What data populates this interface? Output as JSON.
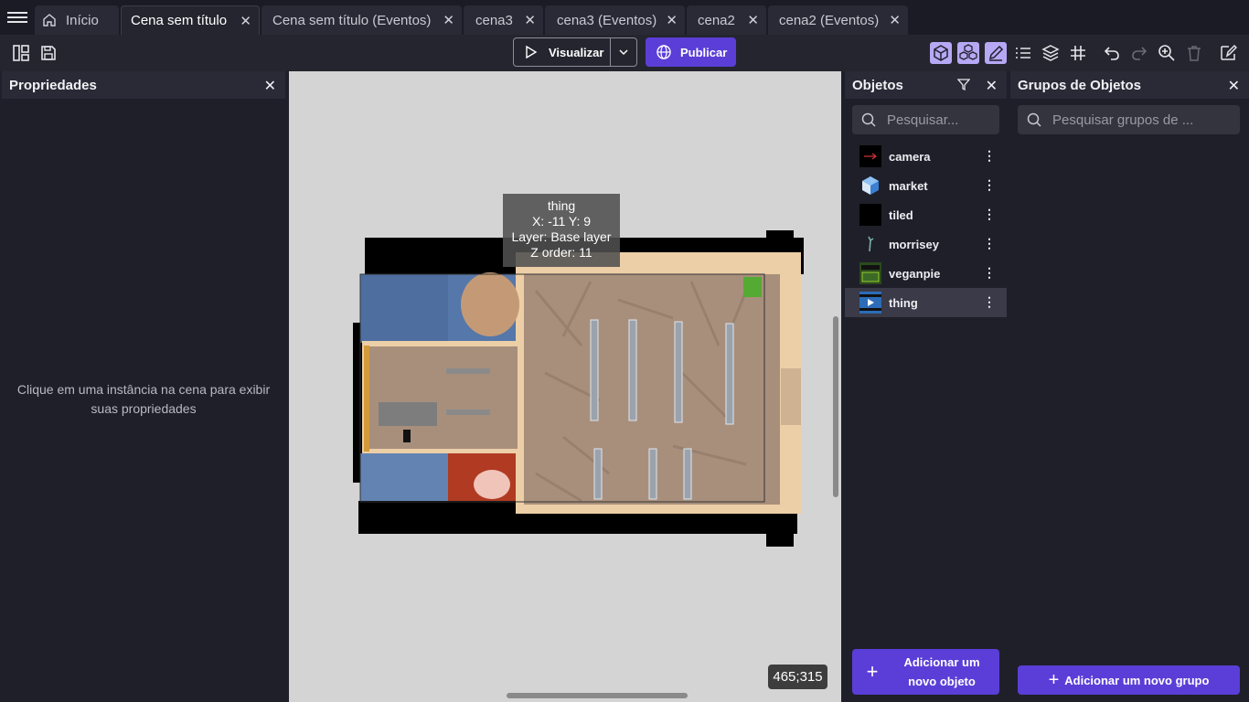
{
  "tabs": [
    {
      "label": "Início",
      "icon": "home-icon"
    },
    {
      "label": "Cena sem título",
      "active": true
    },
    {
      "label": "Cena sem título (Eventos)"
    },
    {
      "label": "cena3"
    },
    {
      "label": "cena3 (Eventos)"
    },
    {
      "label": "cena2"
    },
    {
      "label": "cena2 (Eventos)"
    }
  ],
  "toolbar": {
    "preview_label": "Visualizar",
    "publish_label": "Publicar"
  },
  "properties": {
    "title": "Propriedades",
    "empty_text": "Clique em uma instância na cena para exibir suas propriedades"
  },
  "objects": {
    "title": "Objetos",
    "search_placeholder": "Pesquisar...",
    "items": [
      {
        "name": "camera"
      },
      {
        "name": "market"
      },
      {
        "name": "tiled"
      },
      {
        "name": "morrisey"
      },
      {
        "name": "veganpie"
      },
      {
        "name": "thing",
        "selected": true
      }
    ],
    "add_label": "Adicionar um novo objeto"
  },
  "groups": {
    "title": "Grupos de Objetos",
    "search_placeholder": "Pesquisar grupos de ...",
    "add_label": "Adicionar um novo grupo"
  },
  "canvas": {
    "tooltip_name": "thing",
    "tooltip_pos": "X: -11  Y: 9",
    "tooltip_layer": "Layer: Base layer",
    "tooltip_z": "Z order: 11",
    "cursor_coords": "465;315"
  },
  "colors": {
    "accent": "#5b3ed7",
    "selected_tool": "#b6a8f4",
    "canvas_bg": "#d4d4d4"
  }
}
